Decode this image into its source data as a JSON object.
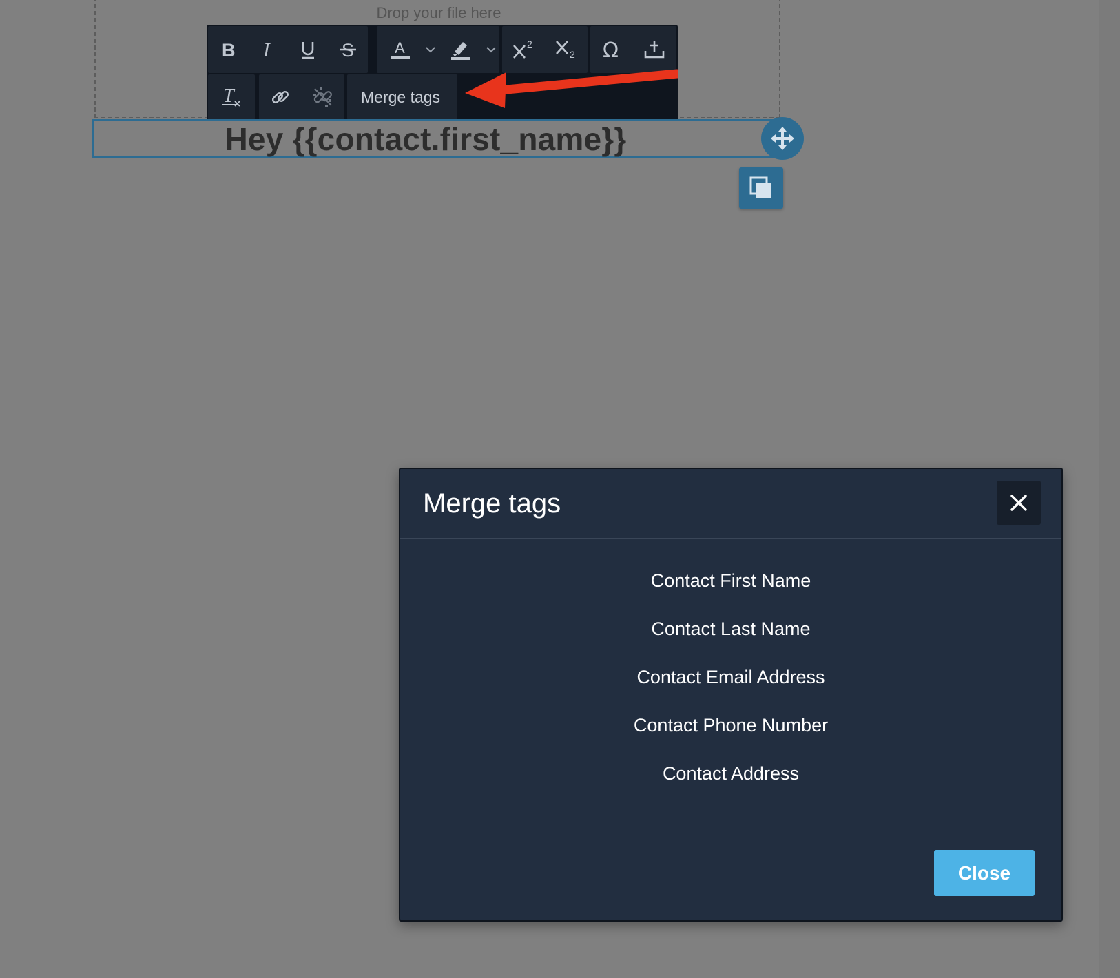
{
  "dropzone": {
    "text": "Drop your file here"
  },
  "toolbar": {
    "merge_tags_label": "Merge tags",
    "superscript_mark": "2",
    "subscript_mark": "2"
  },
  "content": {
    "heading": "Hey {{contact.first_name}}"
  },
  "modal": {
    "title": "Merge tags",
    "items": [
      "Contact First Name",
      "Contact Last Name",
      "Contact Email Address",
      "Contact Phone Number",
      "Contact Address"
    ],
    "close_label": "Close"
  },
  "icons": {
    "bold": "bold-icon",
    "italic": "italic-icon",
    "underline": "underline-icon",
    "strikethrough": "strikethrough-icon",
    "text_color": "text-color-icon",
    "highlight": "highlight-icon",
    "superscript": "superscript-icon",
    "subscript": "subscript-icon",
    "special_char": "omega-icon",
    "insert": "insert-icon",
    "clear_format": "clear-format-icon",
    "link": "link-icon",
    "unlink": "unlink-icon",
    "move": "move-icon",
    "duplicate": "duplicate-icon",
    "close": "close-icon"
  },
  "colors": {
    "accent": "#2d6c92",
    "primary_button": "#4db3e6",
    "modal_bg": "#222e40",
    "toolbar_bg": "#0f151e",
    "annotation_arrow": "#e8341c"
  }
}
